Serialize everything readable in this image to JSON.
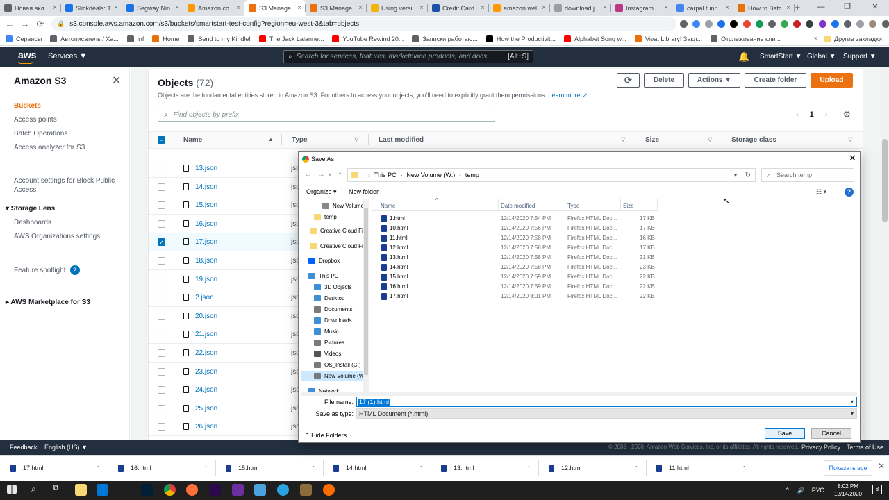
{
  "browser": {
    "tabs": [
      {
        "label": "Новая вкладка",
        "color": "#5f6368",
        "active": false
      },
      {
        "label": "Slickdeals: T",
        "color": "#1a73e8",
        "active": false
      },
      {
        "label": "Segway Nin",
        "color": "#1a73e8",
        "active": false
      },
      {
        "label": "Amazon.co",
        "color": "#ff9900",
        "active": false
      },
      {
        "label": "S3 Manage",
        "color": "#ec7211",
        "active": true
      },
      {
        "label": "S3 Manage",
        "color": "#ec7211",
        "active": false
      },
      {
        "label": "Using versi",
        "color": "#f4b400",
        "active": false
      },
      {
        "label": "Credit Card",
        "color": "#1f4fa8",
        "active": false
      },
      {
        "label": "amazon wel",
        "color": "#ff9900",
        "active": false
      },
      {
        "label": "download j",
        "color": "#9e9e9e",
        "active": false
      },
      {
        "label": "Instagram",
        "color": "#c13584",
        "active": false
      },
      {
        "label": "carpal tunn",
        "color": "#4285f4",
        "active": false
      },
      {
        "label": "How to Batc",
        "color": "#e8710a",
        "active": false
      }
    ],
    "url": "s3.console.aws.amazon.com/s3/buckets/smartstart-test-config?region=eu-west-3&tab=objects",
    "bookmarks": [
      {
        "label": "Сервисы",
        "color": "#4285f4"
      },
      {
        "label": "Автописатель / Ха...",
        "color": "#5f6368"
      },
      {
        "label": "inf",
        "color": "#5f6368"
      },
      {
        "label": "Home",
        "color": "#e8710a"
      },
      {
        "label": "Send to my Kindle!",
        "color": "#5f6368"
      },
      {
        "label": "The Jack Lalanne...",
        "color": "#ff0000"
      },
      {
        "label": "YouTube Rewind 20...",
        "color": "#ff0000"
      },
      {
        "label": "Записки работаю...",
        "color": "#5f6368"
      },
      {
        "label": "How the Productivit...",
        "color": "#000000"
      },
      {
        "label": "Alphabet Song w...",
        "color": "#ff0000"
      },
      {
        "label": "Vivat Library! Закл...",
        "color": "#e8710a"
      },
      {
        "label": "Отслеживание кли...",
        "color": "#5f6368"
      }
    ],
    "bookmarks_more": "»",
    "other_bookmarks": "Другие закладки"
  },
  "aws": {
    "logo": "aws",
    "services": "Services ▼",
    "search_placeholder": "Search for services, features, marketplace products, and docs",
    "search_shortcut": "[Alt+S]",
    "account": "SmartStart ▼",
    "region": "Global ▼",
    "support": "Support ▼",
    "footer": {
      "feedback": "Feedback",
      "language": "English (US) ▼",
      "copyright": "© 2008 - 2020, Amazon Web Services, Inc. or its affiliates. All rights reserved.",
      "privacy": "Privacy Policy",
      "terms": "Terms of Use"
    }
  },
  "sidebar": {
    "title": "Amazon S3",
    "items": [
      {
        "label": "Buckets",
        "style": "orange"
      },
      {
        "label": "Access points",
        "style": "normal"
      },
      {
        "label": "Batch Operations",
        "style": "normal"
      },
      {
        "label": "Access analyzer for S3",
        "style": "normal"
      },
      {
        "label": "Account settings for Block Public Access",
        "style": "wrap"
      },
      {
        "label": "▾ Storage Lens",
        "style": "bold"
      },
      {
        "label": "Dashboards",
        "style": "normal"
      },
      {
        "label": "AWS Organizations settings",
        "style": "normal"
      },
      {
        "label": "Feature spotlight",
        "style": "normal"
      },
      {
        "label": "▸ AWS Marketplace for S3",
        "style": "bold"
      }
    ],
    "spotlight_badge": "2"
  },
  "objects": {
    "title": "Objects",
    "count": "(72)",
    "description": "Objects are the fundamental entities stored in Amazon S3. For others to access your objects, you'll need to explicitly grant them permissions.",
    "learn_more": "Learn more",
    "buttons": {
      "refresh": "⟳",
      "delete": "Delete",
      "actions": "Actions ▼",
      "create_folder": "Create folder",
      "upload": "Upload"
    },
    "filter_placeholder": "Find objects by prefix",
    "page": "1",
    "columns": [
      "Name",
      "Type",
      "Last modified",
      "Size",
      "Storage class"
    ],
    "rows": [
      {
        "name": "13.json",
        "type": "json",
        "checked": false
      },
      {
        "name": "14.json",
        "type": "json",
        "checked": false
      },
      {
        "name": "15.json",
        "type": "json",
        "checked": false
      },
      {
        "name": "16.json",
        "type": "json",
        "checked": false
      },
      {
        "name": "17.json",
        "type": "json",
        "checked": true
      },
      {
        "name": "18.json",
        "type": "json",
        "checked": false
      },
      {
        "name": "19.json",
        "type": "json",
        "checked": false
      },
      {
        "name": "2.json",
        "type": "json",
        "checked": false
      },
      {
        "name": "20.json",
        "type": "json",
        "checked": false
      },
      {
        "name": "21.json",
        "type": "json",
        "checked": false
      },
      {
        "name": "22.json",
        "type": "json",
        "checked": false
      },
      {
        "name": "23.json",
        "type": "json",
        "checked": false
      },
      {
        "name": "24.json",
        "type": "json",
        "checked": false
      },
      {
        "name": "25.json",
        "type": "json",
        "checked": false
      },
      {
        "name": "26.json",
        "type": "json",
        "checked": false
      }
    ]
  },
  "dialog": {
    "title": "Save As",
    "breadcrumb": [
      "This PC",
      "New Volume (W:)",
      "temp"
    ],
    "search_placeholder": "Search temp",
    "organize": "Organize ▾",
    "new_folder": "New folder",
    "nav": [
      {
        "label": "New Volume (W",
        "color": "#888888",
        "selected": false
      },
      {
        "label": "temp",
        "color": "#f8d775",
        "selected": false
      },
      {
        "label": "Creative Cloud Fil",
        "color": "#f8d775",
        "selected": false
      },
      {
        "label": "Creative Cloud Fil",
        "color": "#f8d775",
        "selected": false
      },
      {
        "label": "Dropbox",
        "color": "#0061ff",
        "selected": false
      },
      {
        "label": "This PC",
        "color": "#3d8fd6",
        "selected": false
      },
      {
        "label": "3D Objects",
        "color": "#3d8fd6",
        "selected": false
      },
      {
        "label": "Desktop",
        "color": "#3d8fd6",
        "selected": false
      },
      {
        "label": "Documents",
        "color": "#7a7a7a",
        "selected": false
      },
      {
        "label": "Downloads",
        "color": "#3d8fd6",
        "selected": false
      },
      {
        "label": "Music",
        "color": "#3d8fd6",
        "selected": false
      },
      {
        "label": "Pictures",
        "color": "#7a7a7a",
        "selected": false
      },
      {
        "label": "Videos",
        "color": "#555555",
        "selected": false
      },
      {
        "label": "OS_Install (C:)",
        "color": "#7a7a7a",
        "selected": false
      },
      {
        "label": "New Volume (W",
        "color": "#7a7a7a",
        "selected": true
      },
      {
        "label": "Network",
        "color": "#3d8fd6",
        "selected": false
      }
    ],
    "columns": [
      "Name",
      "Date modified",
      "Type",
      "Size"
    ],
    "files": [
      {
        "name": "1.html",
        "date": "12/14/2020 7:54 PM",
        "type": "Firefox HTML Doc...",
        "size": "17 KB"
      },
      {
        "name": "10.html",
        "date": "12/14/2020 7:56 PM",
        "type": "Firefox HTML Doc...",
        "size": "17 KB"
      },
      {
        "name": "11.html",
        "date": "12/14/2020 7:58 PM",
        "type": "Firefox HTML Doc...",
        "size": "16 KB"
      },
      {
        "name": "12.html",
        "date": "12/14/2020 7:58 PM",
        "type": "Firefox HTML Doc...",
        "size": "17 KB"
      },
      {
        "name": "13.html",
        "date": "12/14/2020 7:58 PM",
        "type": "Firefox HTML Doc...",
        "size": "21 KB"
      },
      {
        "name": "14.html",
        "date": "12/14/2020 7:58 PM",
        "type": "Firefox HTML Doc...",
        "size": "23 KB"
      },
      {
        "name": "15.html",
        "date": "12/14/2020 7:59 PM",
        "type": "Firefox HTML Doc...",
        "size": "22 KB"
      },
      {
        "name": "16.html",
        "date": "12/14/2020 7:59 PM",
        "type": "Firefox HTML Doc...",
        "size": "22 KB"
      },
      {
        "name": "17.html",
        "date": "12/14/2020 8:01 PM",
        "type": "Firefox HTML Doc...",
        "size": "22 KB"
      }
    ],
    "file_name_label": "File name:",
    "file_name_value": "17 (1).html",
    "save_type_label": "Save as type:",
    "save_type_value": "HTML Document (*.html)",
    "hide_folders": "Hide Folders",
    "save": "Save",
    "cancel": "Cancel"
  },
  "downloads": {
    "items": [
      "17.html",
      "16.html",
      "15.html",
      "14.html",
      "13.html",
      "12.html",
      "11.html"
    ],
    "show_all": "Показать все"
  },
  "taskbar": {
    "language": "РУС",
    "time": "8:02 PM",
    "date": "12/14/2020",
    "notifications": "8"
  }
}
